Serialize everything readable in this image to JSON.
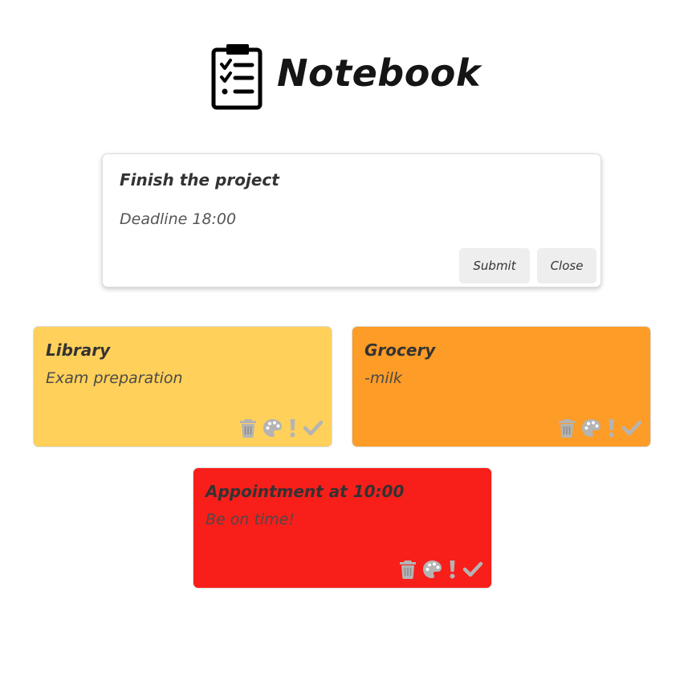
{
  "header": {
    "title": "Notebook",
    "icon": "clipboard-checklist-icon"
  },
  "composer": {
    "title_value": "Finish the project",
    "content_value": "Deadline 18:00",
    "submit_label": "Submit",
    "close_label": "Close"
  },
  "notes": [
    {
      "title": "Library",
      "content": "Exam preparation",
      "color": "#FFD05A"
    },
    {
      "title": "Grocery",
      "content": "-milk",
      "color": "#FD9C26"
    },
    {
      "title": "Appointment at 10:00",
      "content": "Be on time!",
      "color": "#F81E1A"
    }
  ],
  "note_actions": {
    "icons": [
      "trash-icon",
      "palette-icon",
      "exclamation-icon",
      "check-icon"
    ],
    "icon_color": "#B4B4B4"
  }
}
